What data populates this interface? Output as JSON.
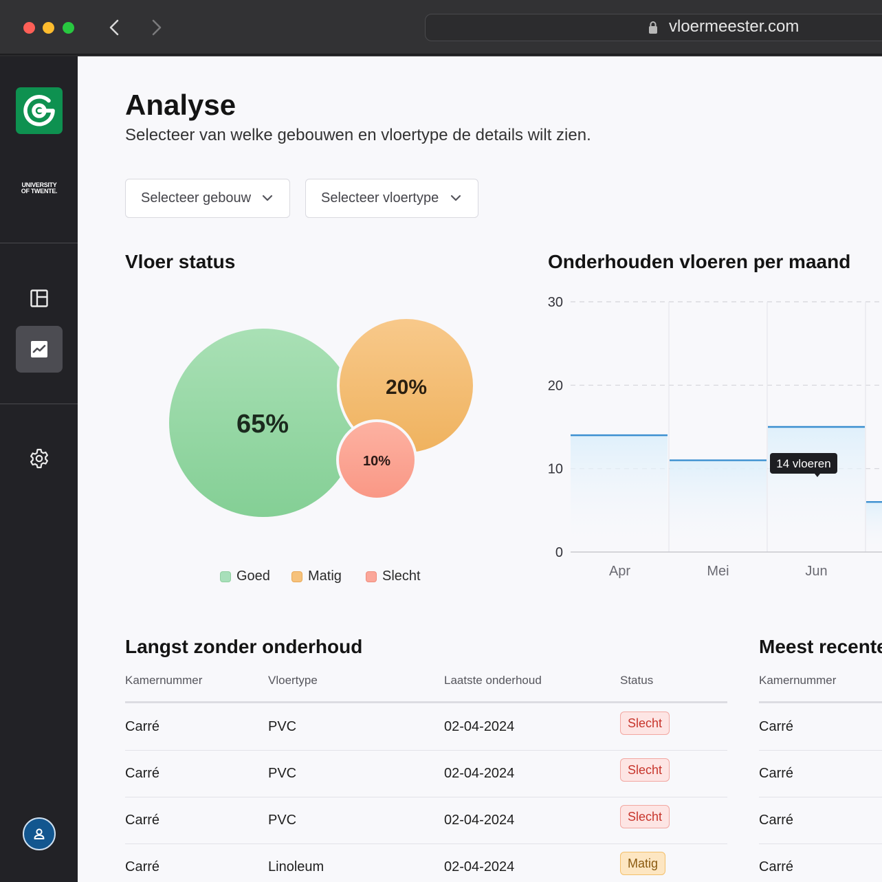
{
  "browser": {
    "url": "vloermeester.com"
  },
  "sidebar": {
    "university": [
      "UNIVERSITY",
      "OF TWENTE."
    ],
    "items": [
      {
        "name": "dashboard",
        "icon": "layout-icon",
        "active": false
      },
      {
        "name": "analyse",
        "icon": "chart-icon",
        "active": true
      },
      {
        "name": "settings",
        "icon": "gear-icon",
        "active": false
      }
    ],
    "user_icon": "user-icon"
  },
  "header": {
    "title": "Analyse",
    "subtitle": "Selecteer van welke gebouwen en vloertype de details wilt zien."
  },
  "filters": {
    "building": "Selecteer gebouw",
    "floortype": "Selecteer vloertype"
  },
  "floor_status": {
    "title": "Vloer status",
    "legend": [
      {
        "label": "Goed",
        "color": "#a8dfba"
      },
      {
        "label": "Matig",
        "color": "#f6c27c"
      },
      {
        "label": "Slecht",
        "color": "#fba79a"
      }
    ],
    "bubbles": [
      {
        "label": "65%",
        "value": 65,
        "color": "#8fd6a1"
      },
      {
        "label": "20%",
        "value": 20,
        "color": "#f3bb6f"
      },
      {
        "label": "10%",
        "value": 10,
        "color": "#fa9d8b"
      }
    ]
  },
  "maintenance": {
    "title": "Onderhouden vloeren per maand",
    "tooltip": "14 vloeren"
  },
  "chart_data": {
    "type": "area",
    "categories": [
      "Apr",
      "Mei",
      "Jun",
      ""
    ],
    "values": [
      14,
      11,
      15,
      6
    ],
    "ylim": [
      0,
      30
    ],
    "yticks": [
      0,
      10,
      20,
      30
    ],
    "grid": true,
    "line_color": "#3b8fd0"
  },
  "table_left": {
    "title": "Langst zonder onderhoud",
    "columns": [
      "Kamernummer",
      "Vloertype",
      "Laatste onderhoud",
      "Status"
    ],
    "rows": [
      {
        "room": "Carré",
        "type": "PVC",
        "date": "02-04-2024",
        "status": "Slecht"
      },
      {
        "room": "Carré",
        "type": "PVC",
        "date": "02-04-2024",
        "status": "Slecht"
      },
      {
        "room": "Carré",
        "type": "PVC",
        "date": "02-04-2024",
        "status": "Slecht"
      },
      {
        "room": "Carré",
        "type": "Linoleum",
        "date": "02-04-2024",
        "status": "Matig"
      }
    ]
  },
  "table_right": {
    "title": "Meest recente",
    "columns": [
      "Kamernummer"
    ],
    "rows": [
      "Carré",
      "Carré",
      "Carré",
      "Carré"
    ]
  }
}
